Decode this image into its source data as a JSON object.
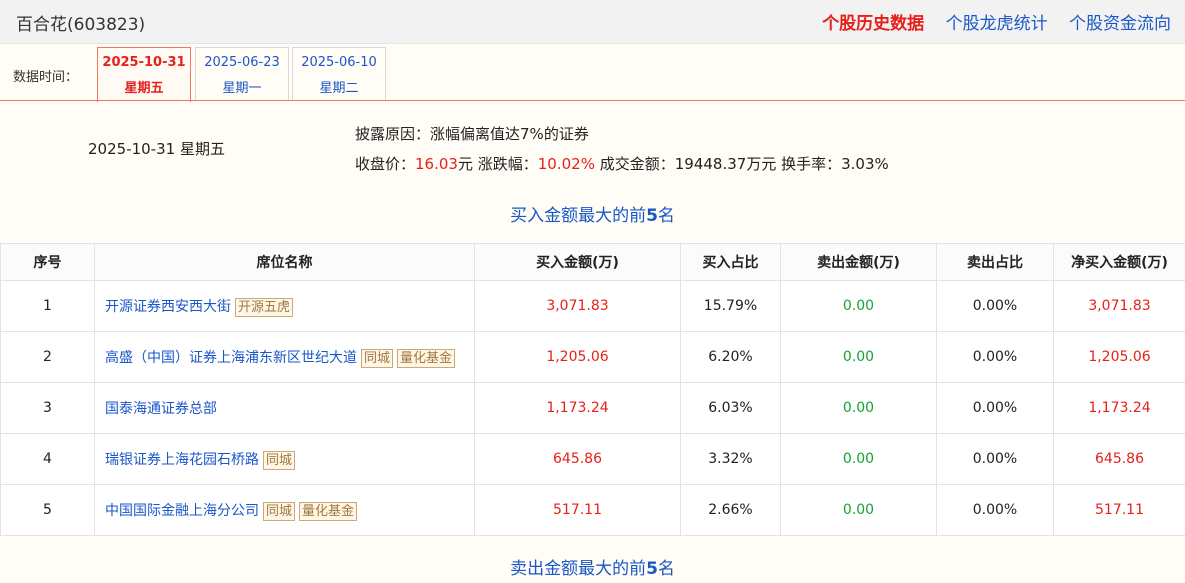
{
  "header": {
    "stock_title": "百合花(603823)",
    "links": [
      "个股历史数据",
      "个股龙虎统计",
      "个股资金流向"
    ]
  },
  "date_bar": {
    "label": "数据时间：",
    "tabs": [
      {
        "date": "2025-10-31",
        "weekday": "星期五"
      },
      {
        "date": "2025-06-23",
        "weekday": "星期一"
      },
      {
        "date": "2025-06-10",
        "weekday": "星期二"
      }
    ]
  },
  "summary": {
    "date": "2025-10-31 星期五",
    "reason_label": "披露原因：",
    "reason": "涨幅偏离值达7%的证券",
    "close_label": "收盘价：",
    "close_value": "16.03",
    "yuan": "元",
    "change_label": " 涨跌幅：",
    "change_value": "10.02%",
    "turnover_label": " 成交金额：",
    "turnover_value": "19448.37万元",
    "rate_label": " 换手率：",
    "rate_value": "3.03%"
  },
  "colors": {
    "red": "#e6201a",
    "green": "#17a136",
    "link": "#1a57c8"
  },
  "buy_section": {
    "title_prefix": "买入金额最大的前",
    "title_num": "5",
    "title_suffix": "名",
    "columns": [
      "序号",
      "席位名称",
      "买入金额(万)",
      "买入占比",
      "卖出金额(万)",
      "卖出占比",
      "净买入金额(万)"
    ],
    "rows": [
      {
        "idx": "1",
        "name": "开源证券西安西大街",
        "tags": [
          "开源五虎"
        ],
        "buy": "3,071.83",
        "buy_pct": "15.79%",
        "sell": "0.00",
        "sell_pct": "0.00%",
        "net": "3,071.83"
      },
      {
        "idx": "2",
        "name": "高盛（中国）证券上海浦东新区世纪大道",
        "tags": [
          "同城",
          "量化基金"
        ],
        "buy": "1,205.06",
        "buy_pct": "6.20%",
        "sell": "0.00",
        "sell_pct": "0.00%",
        "net": "1,205.06"
      },
      {
        "idx": "3",
        "name": "国泰海通证券总部",
        "tags": [],
        "buy": "1,173.24",
        "buy_pct": "6.03%",
        "sell": "0.00",
        "sell_pct": "0.00%",
        "net": "1,173.24"
      },
      {
        "idx": "4",
        "name": "瑞银证券上海花园石桥路",
        "tags": [
          "同城"
        ],
        "buy": "645.86",
        "buy_pct": "3.32%",
        "sell": "0.00",
        "sell_pct": "0.00%",
        "net": "645.86"
      },
      {
        "idx": "5",
        "name": "中国国际金融上海分公司",
        "tags": [
          "同城",
          "量化基金"
        ],
        "buy": "517.11",
        "buy_pct": "2.66%",
        "sell": "0.00",
        "sell_pct": "0.00%",
        "net": "517.11"
      }
    ]
  },
  "sell_section": {
    "title_prefix": "卖出金额最大的前",
    "title_num": "5",
    "title_suffix": "名"
  }
}
